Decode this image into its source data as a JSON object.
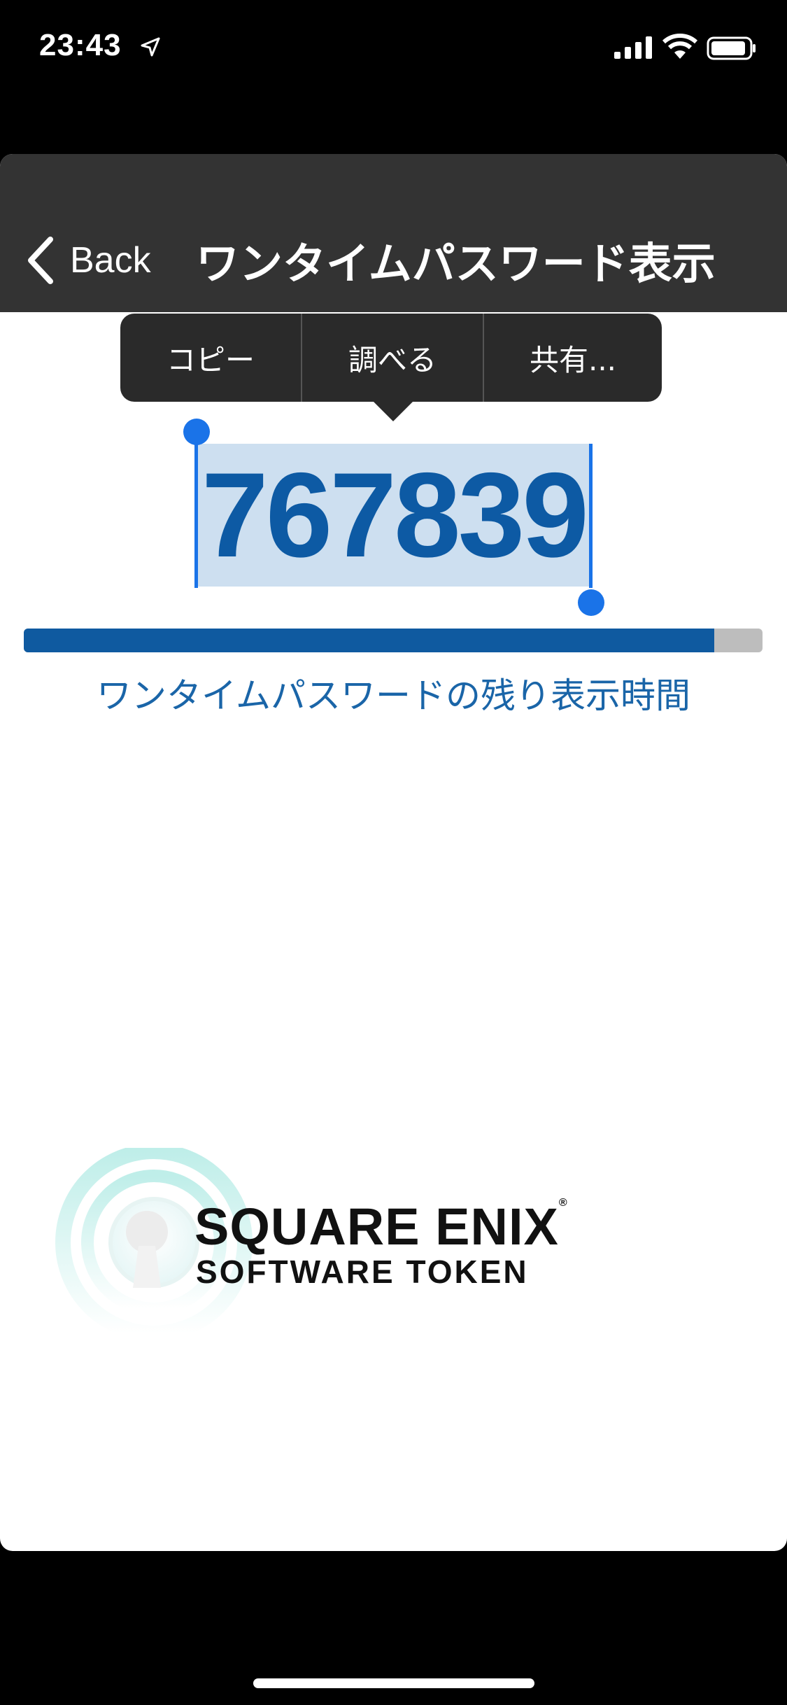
{
  "status_bar": {
    "time": "23:43"
  },
  "nav": {
    "back_label": "Back",
    "title": "ワンタイムパスワード表示"
  },
  "edit_menu": {
    "items": [
      "コピー",
      "調べる",
      "共有..."
    ]
  },
  "otp": {
    "code": "767839"
  },
  "timer": {
    "remaining_fraction": 0.935,
    "label": "ワンタイムパスワードの残り表示時間"
  },
  "logo": {
    "line1": "SQUARE ENIX",
    "line2": "SOFTWARE TOKEN",
    "registered": "®"
  },
  "colors": {
    "nav_bg": "#333333",
    "code_blue": "#0d5aa4",
    "progress_fill": "#0f5aa0",
    "selection": "#cddff0",
    "handle": "#1a73e8"
  }
}
